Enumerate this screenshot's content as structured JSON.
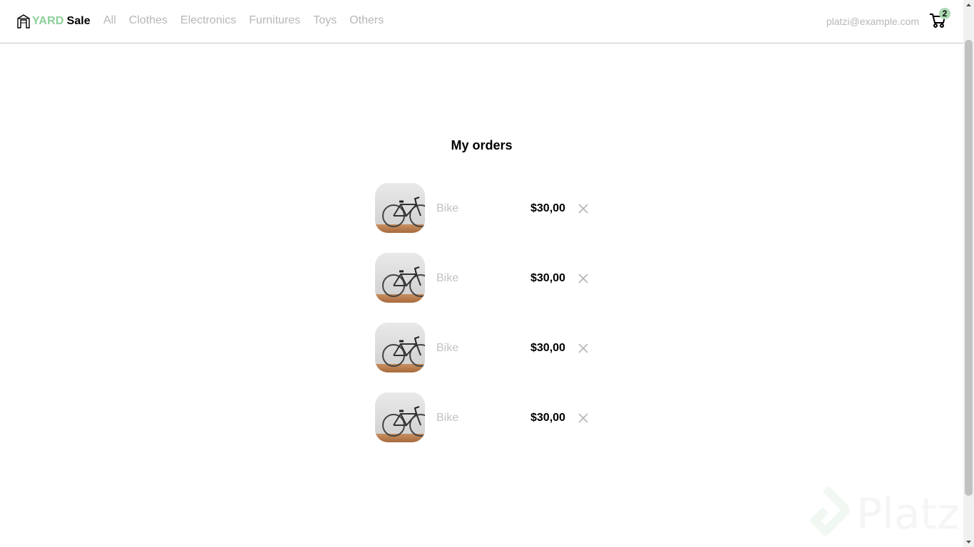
{
  "brand": {
    "part1": "YARD",
    "part2": "Sale",
    "icon": "storefront-icon"
  },
  "nav": {
    "links": [
      "All",
      "Clothes",
      "Electronics",
      "Furnitures",
      "Toys",
      "Others"
    ]
  },
  "user": {
    "email": "platzi@example.com"
  },
  "cart": {
    "count": "2",
    "icon": "shopping-cart-icon"
  },
  "orders": {
    "title": "My orders",
    "items": [
      {
        "name": "Bike",
        "price": "$30,00",
        "image": "bike-image",
        "remove_icon": "close-icon"
      },
      {
        "name": "Bike",
        "price": "$30,00",
        "image": "bike-image",
        "remove_icon": "close-icon"
      },
      {
        "name": "Bike",
        "price": "$30,00",
        "image": "bike-image",
        "remove_icon": "close-icon"
      },
      {
        "name": "Bike",
        "price": "$30,00",
        "image": "bike-image",
        "remove_icon": "close-icon"
      }
    ]
  },
  "watermark": {
    "text": "Platzi"
  },
  "colors": {
    "brand_green": "#8ccf98",
    "badge_green": "#acd9b2",
    "muted_text": "#b7b7b7"
  }
}
